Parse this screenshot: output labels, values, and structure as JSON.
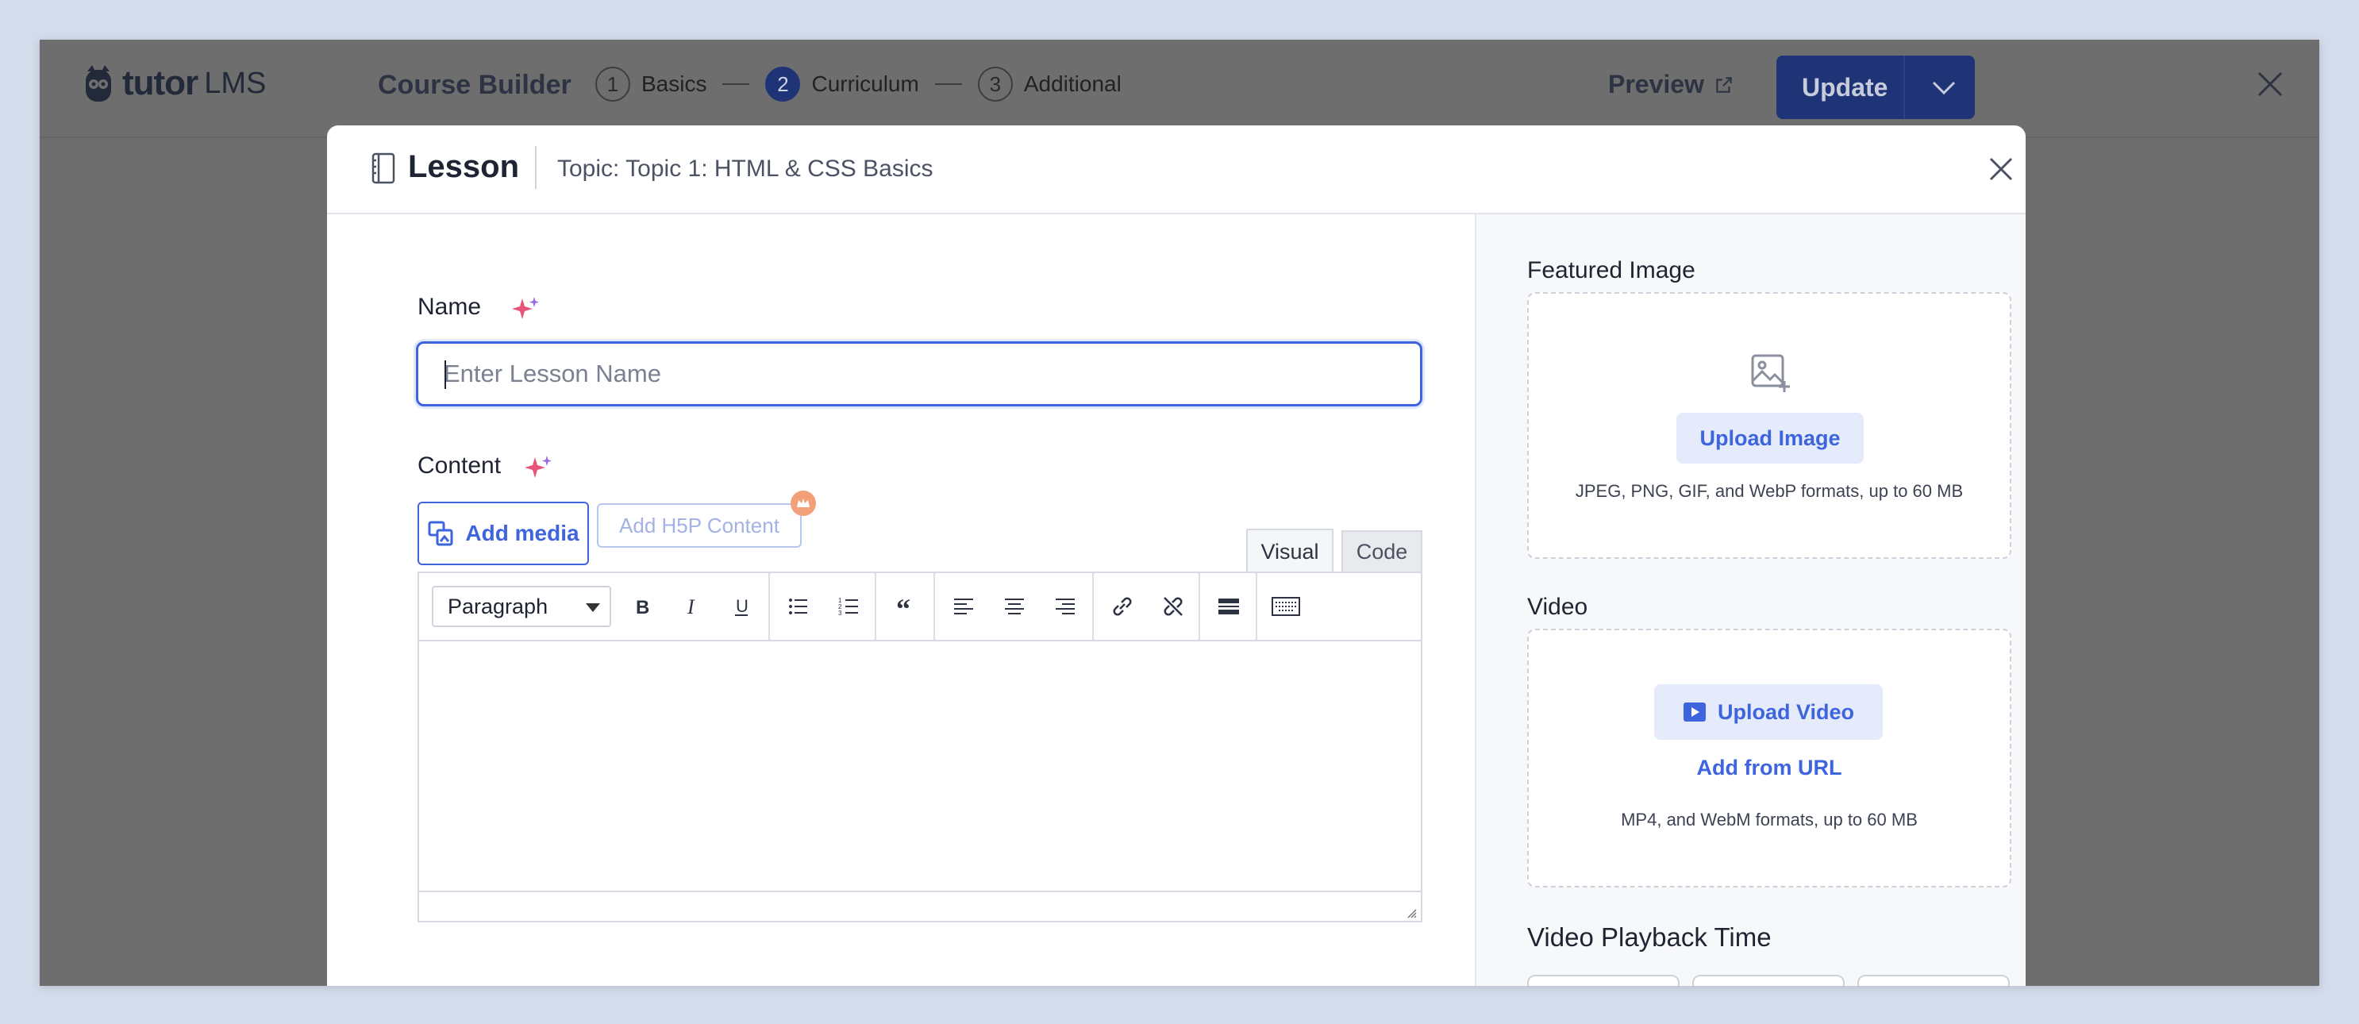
{
  "header": {
    "logo_text": "tutor",
    "logo_suffix": "LMS",
    "builder_title": "Course Builder",
    "steps": [
      {
        "number": "1",
        "label": "Basics"
      },
      {
        "number": "2",
        "label": "Curriculum"
      },
      {
        "number": "3",
        "label": "Additional"
      }
    ],
    "active_step": 2,
    "preview_label": "Preview",
    "update_label": "Update"
  },
  "modal": {
    "title": "Lesson",
    "topic": "Topic: Topic 1: HTML & CSS Basics",
    "name_label": "Name",
    "name_placeholder": "Enter Lesson Name",
    "name_value": "",
    "content_label": "Content",
    "add_media_label": "Add media",
    "add_h5p_label": "Add H5P Content",
    "tabs": [
      {
        "label": "Visual",
        "active": true
      },
      {
        "label": "Code",
        "active": false
      }
    ],
    "format_select_value": "Paragraph",
    "toolbar_icons": [
      "bold-icon",
      "italic-icon",
      "underline-icon",
      "bullet-list-icon",
      "numbered-list-icon",
      "blockquote-icon",
      "align-left-icon",
      "align-center-icon",
      "align-right-icon",
      "link-icon",
      "unlink-icon",
      "read-more-icon",
      "toolbar-toggle-icon"
    ]
  },
  "sidebar": {
    "featured_image_label": "Featured Image",
    "upload_image_label": "Upload Image",
    "image_hint": "JPEG, PNG, GIF, and WebP formats, up to 60 MB",
    "video_label": "Video",
    "upload_video_label": "Upload Video",
    "add_from_url_label": "Add from URL",
    "video_hint": "MP4, and WebM formats, up to 60 MB",
    "playback_label": "Video Playback Time"
  },
  "colors": {
    "accent": "#3e64de",
    "overlay": "#6e6e6e",
    "update_button": "#1f3477",
    "ai_sparkle": "#e8537a"
  }
}
